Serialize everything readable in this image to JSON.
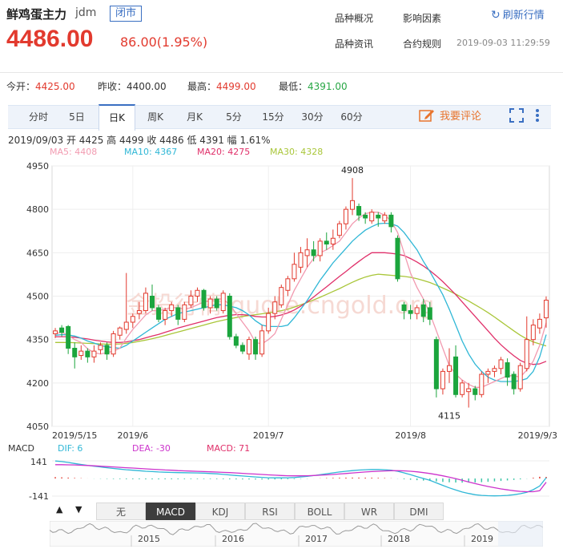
{
  "header": {
    "name": "鲜鸡蛋主力",
    "code": "jdm",
    "state_badge": "闭市",
    "price": "4486.00",
    "change": "86.00(1.95%)",
    "links": [
      "品种概况",
      "影响因素",
      "品种资讯",
      "合约规则"
    ],
    "refresh_label": "刷新行情",
    "timestamp": "2019-09-03 11:29:59"
  },
  "stats": [
    {
      "label": "今开：",
      "value": "4425.00",
      "color": "red"
    },
    {
      "label": "昨收：",
      "value": "4400.00",
      "color": "plain"
    },
    {
      "label": "最高：",
      "value": "4499.00",
      "color": "red"
    },
    {
      "label": "最低：",
      "value": "4391.00",
      "color": "green"
    }
  ],
  "tabs": [
    "分时",
    "5日",
    "日K",
    "周K",
    "月K",
    "5分",
    "15分",
    "30分",
    "60分"
  ],
  "active_tab": "日K",
  "comment_label": "我要评论",
  "info_line": "2019/09/03  开 4425  高 4499  收 4486  低 4391  幅 1.61%",
  "ma_labels": [
    {
      "text": "MA5: 4408",
      "color": "#f29ab0"
    },
    {
      "text": "MA10: 4367",
      "color": "#2fb7d6"
    },
    {
      "text": "MA20: 4275",
      "color": "#e0306a"
    },
    {
      "text": "MA30: 4328",
      "color": "#a9c639"
    }
  ],
  "macd_labels": {
    "title": "MACD",
    "dif": "DIF: 6",
    "dea": "DEA: -30",
    "macd": "MACD: 71",
    "top": "141",
    "bottom": "-141"
  },
  "indicator_buttons": [
    "无",
    "MACD",
    "KDJ",
    "RSI",
    "BOLL",
    "WR",
    "DMI"
  ],
  "active_indicator": "MACD",
  "overview_years": [
    "2015",
    "2016",
    "2017",
    "2018",
    "2019"
  ],
  "watermark": "金投行情 quote.cngold.org",
  "colors": {
    "up": "#e23a2e",
    "down": "#1ba53d",
    "ma5": "#f29ab0",
    "ma10": "#2fb7d6",
    "ma20": "#e0306a",
    "ma30": "#a9c639",
    "dif": "#2fb7d6",
    "dea": "#cc33cc"
  },
  "chart_data": {
    "type": "candlestick",
    "ylim": [
      4050,
      4950
    ],
    "yticks": [
      4950,
      4800,
      4650,
      4500,
      4350,
      4200,
      4050
    ],
    "date_labels": [
      {
        "text": "2019/5/15",
        "index": 0
      },
      {
        "text": "2019/6",
        "index": 12
      },
      {
        "text": "2019/7",
        "index": 33
      },
      {
        "text": "2019/8",
        "index": 55
      },
      {
        "text": "2019/9/3",
        "index": 76
      }
    ],
    "annotations": [
      {
        "text": "4908",
        "index": 46,
        "value": 4908
      },
      {
        "text": "4115",
        "index": 61,
        "value": 4115
      }
    ],
    "candles": [
      [
        4370,
        4380,
        4355,
        4390
      ],
      [
        4390,
        4375,
        4360,
        4400
      ],
      [
        4395,
        4320,
        4300,
        4400
      ],
      [
        4320,
        4290,
        4250,
        4340
      ],
      [
        4295,
        4310,
        4280,
        4330
      ],
      [
        4310,
        4290,
        4270,
        4320
      ],
      [
        4290,
        4310,
        4270,
        4330
      ],
      [
        4315,
        4330,
        4300,
        4340
      ],
      [
        4330,
        4300,
        4280,
        4340
      ],
      [
        4300,
        4370,
        4290,
        4380
      ],
      [
        4365,
        4390,
        4350,
        4395
      ],
      [
        4385,
        4410,
        4370,
        4580
      ],
      [
        4410,
        4430,
        4390,
        4440
      ],
      [
        4440,
        4450,
        4420,
        4480
      ],
      [
        4450,
        4510,
        4440,
        4530
      ],
      [
        4500,
        4460,
        4450,
        4540
      ],
      [
        4460,
        4420,
        4410,
        4470
      ],
      [
        4420,
        4450,
        4400,
        4460
      ],
      [
        4450,
        4470,
        4430,
        4480
      ],
      [
        4460,
        4420,
        4400,
        4470
      ],
      [
        4420,
        4470,
        4410,
        4480
      ],
      [
        4470,
        4500,
        4460,
        4520
      ],
      [
        4500,
        4520,
        4480,
        4530
      ],
      [
        4520,
        4460,
        4450,
        4525
      ],
      [
        4460,
        4490,
        4440,
        4500
      ],
      [
        4490,
        4460,
        4450,
        4500
      ],
      [
        4450,
        4510,
        4440,
        4520
      ],
      [
        4500,
        4360,
        4350,
        4510
      ],
      [
        4360,
        4330,
        4320,
        4370
      ],
      [
        4330,
        4310,
        4300,
        4340
      ],
      [
        4300,
        4350,
        4280,
        4360
      ],
      [
        4350,
        4300,
        4280,
        4360
      ],
      [
        4300,
        4380,
        4290,
        4400
      ],
      [
        4380,
        4440,
        4370,
        4460
      ],
      [
        4440,
        4480,
        4420,
        4500
      ],
      [
        4470,
        4530,
        4460,
        4540
      ],
      [
        4520,
        4560,
        4500,
        4570
      ],
      [
        4560,
        4610,
        4550,
        4650
      ],
      [
        4600,
        4650,
        4580,
        4670
      ],
      [
        4640,
        4660,
        4600,
        4700
      ],
      [
        4660,
        4640,
        4620,
        4690
      ],
      [
        4640,
        4690,
        4620,
        4700
      ],
      [
        4690,
        4680,
        4660,
        4720
      ],
      [
        4680,
        4700,
        4660,
        4730
      ],
      [
        4710,
        4750,
        4700,
        4760
      ],
      [
        4750,
        4800,
        4730,
        4810
      ],
      [
        4800,
        4830,
        4780,
        4908
      ],
      [
        4810,
        4780,
        4760,
        4820
      ],
      [
        4780,
        4770,
        4750,
        4790
      ],
      [
        4760,
        4790,
        4750,
        4800
      ],
      [
        4780,
        4770,
        4740,
        4790
      ],
      [
        4760,
        4780,
        4750,
        4790
      ],
      [
        4780,
        4740,
        4720,
        4790
      ],
      [
        4700,
        4560,
        4550,
        4710
      ],
      [
        4470,
        4450,
        4420,
        4480
      ],
      [
        4450,
        4440,
        4420,
        4470
      ],
      [
        4440,
        4460,
        4420,
        4470
      ],
      [
        4470,
        4430,
        4410,
        4490
      ],
      [
        4460,
        4420,
        4400,
        4480
      ],
      [
        4350,
        4180,
        4150,
        4360
      ],
      [
        4180,
        4240,
        4160,
        4250
      ],
      [
        4240,
        4260,
        4200,
        4320
      ],
      [
        4290,
        4160,
        4150,
        4330
      ],
      [
        4160,
        4200,
        4150,
        4210
      ],
      [
        4170,
        4180,
        4115,
        4200
      ],
      [
        4180,
        4160,
        4140,
        4190
      ],
      [
        4160,
        4230,
        4150,
        4240
      ],
      [
        4230,
        4240,
        4200,
        4250
      ],
      [
        4240,
        4250,
        4220,
        4260
      ],
      [
        4250,
        4280,
        4230,
        4290
      ],
      [
        4270,
        4220,
        4190,
        4285
      ],
      [
        4230,
        4180,
        4160,
        4240
      ],
      [
        4180,
        4260,
        4170,
        4270
      ],
      [
        4250,
        4350,
        4240,
        4430
      ],
      [
        4350,
        4400,
        4330,
        4420
      ],
      [
        4390,
        4420,
        4370,
        4440
      ],
      [
        4425,
        4486,
        4391,
        4499
      ]
    ],
    "ma5": [
      4370,
      4375,
      4365,
      4350,
      4340,
      4318,
      4305,
      4300,
      4305,
      4310,
      4320,
      4355,
      4385,
      4410,
      4435,
      4450,
      4450,
      4455,
      4460,
      4460,
      4455,
      4460,
      4470,
      4480,
      4485,
      4490,
      4490,
      4470,
      4440,
      4410,
      4380,
      4340,
      4335,
      4350,
      4370,
      4420,
      4470,
      4520,
      4560,
      4600,
      4630,
      4650,
      4660,
      4675,
      4690,
      4720,
      4750,
      4770,
      4785,
      4790,
      4790,
      4780,
      4760,
      4720,
      4650,
      4580,
      4530,
      4490,
      4440,
      4380,
      4320,
      4260,
      4230,
      4210,
      4195,
      4185,
      4185,
      4195,
      4205,
      4215,
      4225,
      4225,
      4220,
      4245,
      4275,
      4330,
      4408
    ],
    "ma10": [
      4365,
      4367,
      4366,
      4362,
      4355,
      4345,
      4338,
      4330,
      4325,
      4322,
      4320,
      4330,
      4345,
      4360,
      4375,
      4390,
      4405,
      4420,
      4430,
      4440,
      4445,
      4450,
      4455,
      4460,
      4465,
      4470,
      4470,
      4465,
      4460,
      4450,
      4435,
      4415,
      4400,
      4395,
      4395,
      4395,
      4400,
      4425,
      4455,
      4485,
      4520,
      4555,
      4585,
      4615,
      4640,
      4665,
      4690,
      4710,
      4728,
      4740,
      4750,
      4752,
      4750,
      4742,
      4720,
      4690,
      4660,
      4620,
      4585,
      4545,
      4505,
      4455,
      4400,
      4345,
      4300,
      4265,
      4240,
      4220,
      4210,
      4205,
      4205,
      4205,
      4208,
      4215,
      4240,
      4290,
      4367
    ],
    "ma20": [
      4360,
      4360,
      4360,
      4358,
      4355,
      4352,
      4348,
      4345,
      4342,
      4340,
      4340,
      4342,
      4346,
      4350,
      4356,
      4362,
      4368,
      4375,
      4382,
      4390,
      4396,
      4402,
      4408,
      4414,
      4420,
      4426,
      4430,
      4434,
      4436,
      4436,
      4434,
      4430,
      4428,
      4428,
      4430,
      4435,
      4442,
      4452,
      4465,
      4480,
      4497,
      4515,
      4532,
      4550,
      4568,
      4585,
      4603,
      4620,
      4636,
      4650,
      4650,
      4650,
      4648,
      4645,
      4640,
      4630,
      4618,
      4604,
      4588,
      4570,
      4550,
      4528,
      4505,
      4480,
      4455,
      4430,
      4405,
      4380,
      4355,
      4332,
      4312,
      4294,
      4278,
      4268,
      4264,
      4266,
      4275
    ],
    "ma30": [
      4340,
      4340,
      4340,
      4339,
      4338,
      4337,
      4336,
      4335,
      4334,
      4334,
      4335,
      4337,
      4340,
      4344,
      4348,
      4353,
      4358,
      4364,
      4370,
      4376,
      4382,
      4388,
      4394,
      4400,
      4406,
      4412,
      4417,
      4422,
      4426,
      4430,
      4433,
      4436,
      4439,
      4442,
      4446,
      4450,
      4455,
      4462,
      4470,
      4478,
      4487,
      4496,
      4506,
      4516,
      4526,
      4537,
      4548,
      4558,
      4566,
      4572,
      4576,
      4574,
      4572,
      4570,
      4568,
      4565,
      4560,
      4554,
      4547,
      4538,
      4528,
      4518,
      4507,
      4495,
      4483,
      4470,
      4457,
      4443,
      4428,
      4412,
      4396,
      4380,
      4365,
      4352,
      4342,
      4335,
      4328
    ],
    "macd": {
      "ylim": [
        -141,
        141
      ],
      "dif": [
        140,
        135,
        128,
        120,
        112,
        105,
        98,
        92,
        86,
        80,
        75,
        70,
        66,
        62,
        58,
        55,
        52,
        50,
        48,
        47,
        46,
        45,
        44,
        43,
        40,
        37,
        33,
        28,
        24,
        20,
        16,
        12,
        9,
        6,
        5,
        5,
        6,
        8,
        12,
        17,
        23,
        30,
        38,
        45,
        52,
        58,
        63,
        67,
        70,
        72,
        72,
        70,
        66,
        58,
        45,
        30,
        15,
        0,
        -15,
        -35,
        -55,
        -75,
        -92,
        -108,
        -120,
        -130,
        -135,
        -138,
        -139,
        -138,
        -135,
        -130,
        -122,
        -110,
        -90,
        -60,
        6
      ],
      "dea": [
        110,
        110,
        109,
        108,
        106,
        104,
        101,
        98,
        95,
        92,
        89,
        86,
        83,
        80,
        77,
        74,
        71,
        68,
        66,
        63,
        61,
        59,
        57,
        55,
        53,
        51,
        49,
        47,
        44,
        41,
        38,
        35,
        32,
        29,
        26,
        24,
        22,
        21,
        21,
        22,
        24,
        26,
        29,
        32,
        36,
        40,
        44,
        48,
        52,
        55,
        58,
        60,
        62,
        62,
        61,
        58,
        53,
        47,
        40,
        31,
        21,
        10,
        -2,
        -15,
        -28,
        -41,
        -53,
        -64,
        -74,
        -83,
        -91,
        -98,
        -103,
        -106,
        -106,
        -98,
        -30
      ],
      "hist": [
        60,
        50,
        38,
        24,
        12,
        2,
        -6,
        -12,
        -18,
        -24,
        -28,
        -32,
        -34,
        -36,
        -38,
        -38,
        -38,
        -36,
        -36,
        -32,
        -30,
        -28,
        -26,
        -24,
        -26,
        -28,
        -32,
        -38,
        -40,
        -42,
        -44,
        -46,
        -46,
        -46,
        -42,
        -38,
        -32,
        -26,
        -18,
        -10,
        -2,
        8,
        18,
        26,
        32,
        36,
        38,
        38,
        36,
        34,
        28,
        20,
        8,
        -8,
        -32,
        -56,
        -76,
        -94,
        -110,
        -132,
        -152,
        -170,
        -180,
        -186,
        -184,
        -178,
        -164,
        -148,
        -130,
        -110,
        -88,
        -64,
        -38,
        -8,
        32,
        76,
        71
      ]
    }
  }
}
